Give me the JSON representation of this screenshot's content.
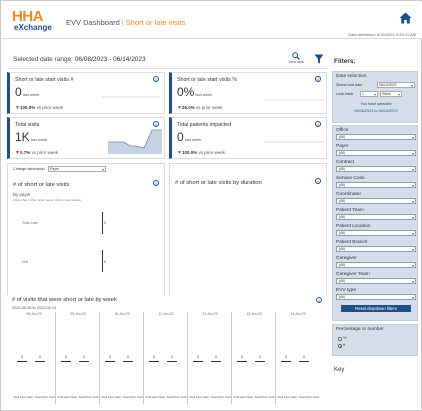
{
  "header": {
    "logo_top": "HHA",
    "logo_bottom": "eXchange",
    "title": "EVV Dashboard",
    "subtitle": "Short or late visits",
    "separator": "|",
    "refreshed": "Data refreshed: 6/15/2023 3:33:21 AM"
  },
  "main": {
    "date_range_label": "Selected date range:",
    "date_range": "06/08/2023 - 06/14/2023",
    "view_data_label": "View data",
    "kpi_cards": [
      {
        "title": "Short or late start visits #",
        "value": "0",
        "unit": "last week",
        "change": "100.0%",
        "change_dir": "down",
        "vs": "vs prior week"
      },
      {
        "title": "Short or late start visits %",
        "value": "0%",
        "unit": "last week",
        "change": "25.0%",
        "change_dir": "down",
        "vs": "vs prior week"
      },
      {
        "title": "Total visits",
        "value": "1K",
        "unit": "last week",
        "change": "0.7%",
        "change_dir": "down",
        "vs": "vs prior week"
      },
      {
        "title": "Total patients impacted",
        "value": "0",
        "unit": "last week",
        "change": "100.0%",
        "change_dir": "down",
        "vs": "vs prior week"
      }
    ],
    "change_dimension_label": "Change dimension",
    "change_dimension_value": "Payer",
    "by_payer": {
      "title": "# of short or late visits",
      "subtitle": "By payer",
      "hint": "Click a bar to filter other views. Click to view details",
      "rows": [
        {
          "label": "Total Late",
          "value": "0"
        },
        {
          "label": "N/A",
          "value": "0"
        }
      ]
    },
    "by_duration": {
      "title": "# of short or late visits by duration"
    },
    "by_week": {
      "title": "# of visits that were short or late by week",
      "range": "2023-06-08 to 2023-06-14",
      "days": [
        {
          "date": "08-Jun-23",
          "v1": "0",
          "v2": "0"
        },
        {
          "date": "09-Jun-23",
          "v1": "0",
          "v2": "0"
        },
        {
          "date": "10-Jun-23",
          "v1": "0",
          "v2": "0"
        },
        {
          "date": "11-Jun-23",
          "v1": "0",
          "v2": "0"
        },
        {
          "date": "12-Jun-23",
          "v1": "0",
          "v2": "0"
        },
        {
          "date": "13-Jun-23",
          "v1": "0",
          "v2": "0"
        },
        {
          "date": "14-Jun-23",
          "v1": "0",
          "v2": "0"
        }
      ],
      "col_a": "Total Late Visits",
      "col_b": "Total Short Visits"
    }
  },
  "sidebar": {
    "title": "Filters:",
    "date_selection": {
      "label": "Date selection",
      "select_end_date_label": "Select end date",
      "end_date": "06/14/2023",
      "look_back_label": "Look back",
      "look_back_value": "1",
      "period_value": "Week",
      "you_have_selected": "You have selected",
      "selected_range": "06/08/2023 to 06/14/2023"
    },
    "filters": [
      {
        "label": "Office",
        "value": "(All)"
      },
      {
        "label": "Payer",
        "value": "(All)"
      },
      {
        "label": "Contract",
        "value": "(All)"
      },
      {
        "label": "Service Code",
        "value": "(All)"
      },
      {
        "label": "Coordinator",
        "value": "(All)"
      },
      {
        "label": "Patient Team",
        "value": "(All)"
      },
      {
        "label": "Patient Location",
        "value": "(All)"
      },
      {
        "label": "Patient Branch",
        "value": "(All)"
      },
      {
        "label": "Caregiver",
        "value": "(All)"
      },
      {
        "label": "Caregiver Team",
        "value": "(All)"
      },
      {
        "label": "EVV type",
        "value": "(All)"
      }
    ],
    "reset_label": "Reset dropdown filters",
    "percentage_or_number": {
      "label": "Percentage or number",
      "options": [
        "%",
        "#"
      ],
      "selected": "#"
    },
    "key_label": "Key"
  },
  "colors": {
    "brand_orange": "#f08a24",
    "brand_navy": "#1f4f8b",
    "filter_panel": "#d5dde9"
  }
}
